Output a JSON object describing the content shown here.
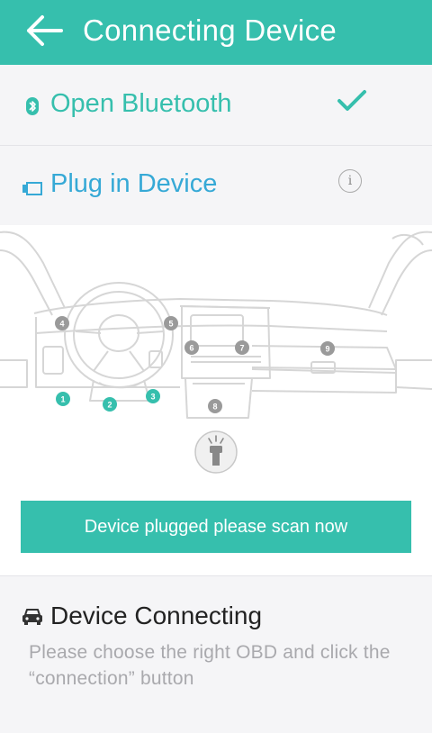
{
  "header": {
    "title": "Connecting Device"
  },
  "steps": {
    "bluetooth": {
      "label": "Open Bluetooth",
      "status": "done"
    },
    "plug": {
      "label": "Plug in Device",
      "info_symbol": "i"
    }
  },
  "ports": [
    {
      "label": "1",
      "highlight": true
    },
    {
      "label": "2",
      "highlight": true
    },
    {
      "label": "3",
      "highlight": true
    },
    {
      "label": "4",
      "highlight": false
    },
    {
      "label": "5",
      "highlight": false
    },
    {
      "label": "6",
      "highlight": false
    },
    {
      "label": "7",
      "highlight": false
    },
    {
      "label": "8",
      "highlight": false
    },
    {
      "label": "9",
      "highlight": false
    }
  ],
  "scan_button": {
    "label": "Device plugged please scan now"
  },
  "connecting": {
    "title": "Device Connecting",
    "description": "Please choose the right OBD and click the “connection” button"
  },
  "colors": {
    "accent": "#36bfad",
    "link_blue": "#36a9d6",
    "port_gray": "#9a9a9a"
  }
}
